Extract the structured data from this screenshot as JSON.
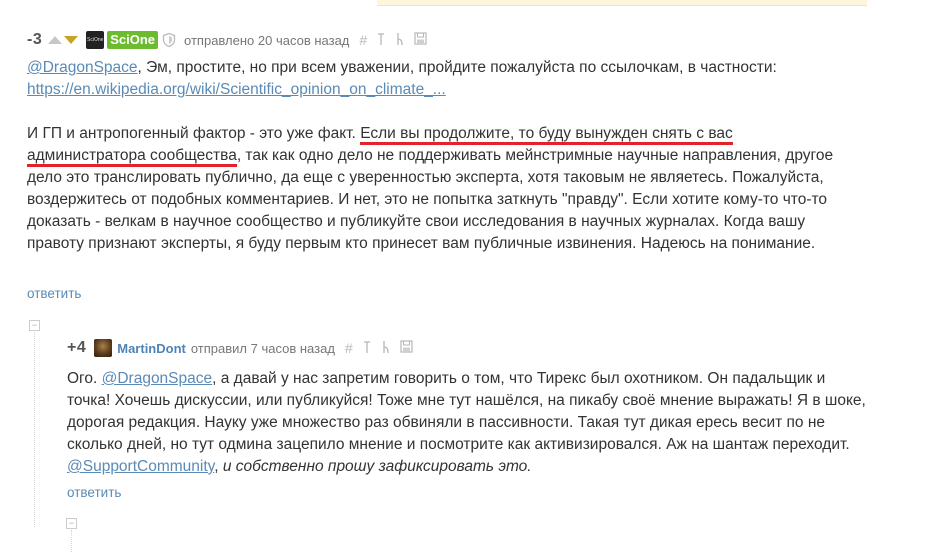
{
  "comment1": {
    "score": "-3",
    "username": "SciOne",
    "meta": "отправлено 20 часов назад",
    "avatar_text": "SciOne",
    "mention": "@DragonSpace",
    "line1_rest": ", Эм, простите, но при всем уважении, пройдите пожалуйста по ссылочкам, в частности:",
    "link": "https://en.wikipedia.org/wiki/Scientific_opinion_on_climate_...",
    "p2_start": "И ГП и антропогенный фактор - это уже факт. ",
    "p2_underlined": "Если вы продолжите, то буду вынужден снять с вас администратора сообщества",
    "p2_rest": ", так как одно дело не поддерживать мейнстримные научные направления, другое дело это транслировать публично, да еще с уверенностью эксперта, хотя таковым не являетесь. Пожалуйста, воздержитесь от подобных комментариев. И нет, это не попытка заткнуть \"правду\". Если хотите кому-то что-то доказать - велкам в научное сообщество и публикуйте свои исследования в научных журналах. Когда вашу правоту признают эксперты, я буду первым кто принесет вам публичные извинения. Надеюсь на понимание.",
    "reply_label": "ответить"
  },
  "comment2": {
    "score": "+4",
    "username": "MartinDont",
    "meta": "отправил 7 часов назад",
    "mention1": "@DragonSpace",
    "text1": ", а давай у нас запретим говорить о том, что Тирекс был охотником. Он падальщик и точка! Хочешь дискуссии, или публикуйся! Тоже мне тут нашёлся, на пикабу своё мнение выражать! Я в шоке, дорогая редакция. Науку уже множество раз обвиняли в пассивности. Такая тут дикая ересь весит по не сколько дней, но тут одмина зацепило мнение и посмотрите как активизировался. Аж на шантаж переходит. ",
    "mention2": "@SupportCommunity",
    "text2": ", ",
    "italic_text": "и собственно прошу зафиксировать это.",
    "reply_label": "ответить"
  },
  "tools": {
    "hash": "#",
    "pin": "⍑",
    "branch": "⍭",
    "save": "save-icon"
  },
  "colors": {
    "link": "#5a8ab6",
    "username": "#4f84b8",
    "badge_green": "#6dbb2e",
    "underline_red": "#e3232b",
    "downvote_gold": "#c9a323"
  }
}
